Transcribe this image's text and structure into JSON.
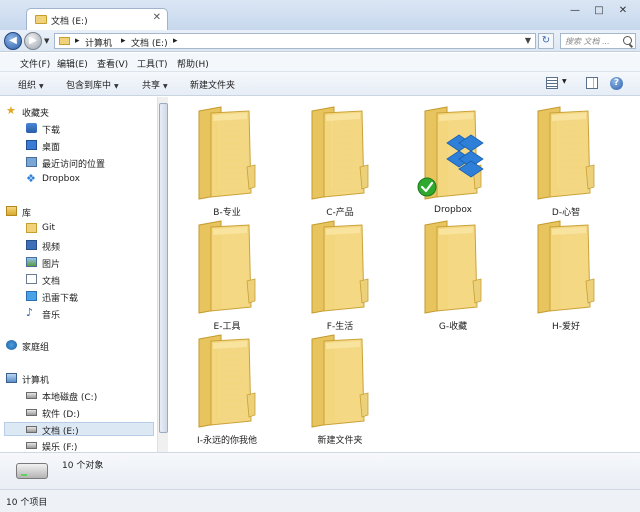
{
  "window": {
    "tab_title": "文档 (E:)",
    "controls": [
      "—",
      "□",
      "✕"
    ]
  },
  "address_bar": {
    "crumbs": [
      "计算机",
      "文档 (E:)"
    ],
    "search_placeholder": "搜索 文档 ..."
  },
  "menu": [
    "文件(F)",
    "编辑(E)",
    "查看(V)",
    "工具(T)",
    "帮助(H)"
  ],
  "toolbar": {
    "organize": "组织",
    "include_in_library": "包含到库中",
    "share": "共享",
    "new_folder": "新建文件夹",
    "help_glyph": "?"
  },
  "sidebar": {
    "favorites": {
      "label": "收藏夹",
      "items": [
        {
          "label": "下载",
          "icon": "download-icon"
        },
        {
          "label": "桌面",
          "icon": "desktop-icon"
        },
        {
          "label": "最近访问的位置",
          "icon": "recent-places-icon"
        },
        {
          "label": "Dropbox",
          "icon": "dropbox-icon"
        }
      ]
    },
    "libraries": {
      "label": "库",
      "items": [
        {
          "label": "Git",
          "icon": "folder-icon"
        },
        {
          "label": "视频",
          "icon": "video-icon"
        },
        {
          "label": "图片",
          "icon": "pictures-icon"
        },
        {
          "label": "文档",
          "icon": "documents-icon"
        },
        {
          "label": "迅雷下载",
          "icon": "xunlei-icon"
        },
        {
          "label": "音乐",
          "icon": "music-icon"
        }
      ]
    },
    "homegroup": {
      "label": "家庭组"
    },
    "computer": {
      "label": "计算机",
      "items": [
        {
          "label": "本地磁盘 (C:)",
          "icon": "drive-icon"
        },
        {
          "label": "软件 (D:)",
          "icon": "drive-icon"
        },
        {
          "label": "文档 (E:)",
          "icon": "drive-icon",
          "selected": true
        },
        {
          "label": "娱乐 (F:)",
          "icon": "drive-icon"
        }
      ]
    }
  },
  "folders": [
    {
      "name": "B-专业",
      "type": "folder-with-files"
    },
    {
      "name": "C-产品",
      "type": "folder-with-files"
    },
    {
      "name": "Dropbox",
      "type": "dropbox-folder",
      "synced": true
    },
    {
      "name": "D-心智",
      "type": "folder-with-files"
    },
    {
      "name": "E-工具",
      "type": "folder-empty"
    },
    {
      "name": "F-生活",
      "type": "folder-empty"
    },
    {
      "name": "G-收藏",
      "type": "folder-empty"
    },
    {
      "name": "H-爱好",
      "type": "folder-empty"
    },
    {
      "name": "I-永远的你我他",
      "type": "folder-with-files"
    },
    {
      "name": "新建文件夹",
      "type": "folder-empty"
    }
  ],
  "details": {
    "count_text": "10 个对象"
  },
  "status": {
    "count_text": "10 个项目"
  },
  "colors": {
    "selection": "#dde8f5",
    "folder_yellow": "#f0d27a",
    "dropbox_blue": "#2d7fd8",
    "sync_green": "#2ea82e"
  }
}
